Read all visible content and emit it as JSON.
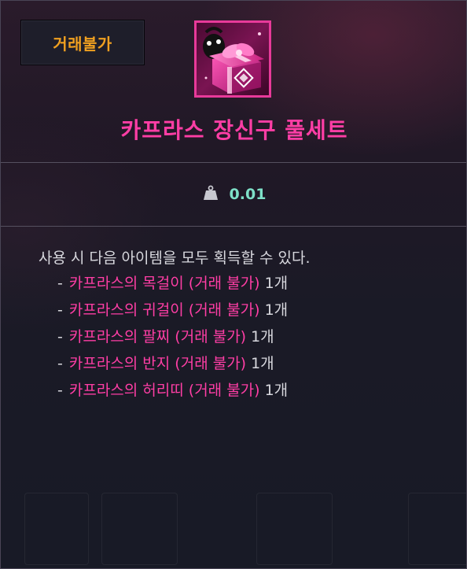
{
  "badge": {
    "label": "거래불가"
  },
  "item": {
    "name": "카프라스 장신구 풀세트",
    "icon": "gift-box-icon"
  },
  "weight": {
    "icon": "weight-icon",
    "value": "0.01"
  },
  "description": {
    "header": "사용 시 다음 아이템을 모두 획득할 수 있다.",
    "items": [
      {
        "bullet": "-",
        "name": "카프라스의 목걸이 (거래 불가)",
        "qty": "1개"
      },
      {
        "bullet": "-",
        "name": "카프라스의 귀걸이 (거래 불가)",
        "qty": "1개"
      },
      {
        "bullet": "-",
        "name": "카프라스의 팔찌 (거래 불가)",
        "qty": "1개"
      },
      {
        "bullet": "-",
        "name": "카프라스의 반지 (거래 불가)",
        "qty": "1개"
      },
      {
        "bullet": "-",
        "name": "카프라스의 허리띠 (거래 불가)",
        "qty": "1개"
      }
    ]
  },
  "colors": {
    "badge_text": "#f0a020",
    "item_name": "#ff3ea5",
    "weight_value": "#7ee0c8",
    "icon_border": "#e83a9a"
  }
}
